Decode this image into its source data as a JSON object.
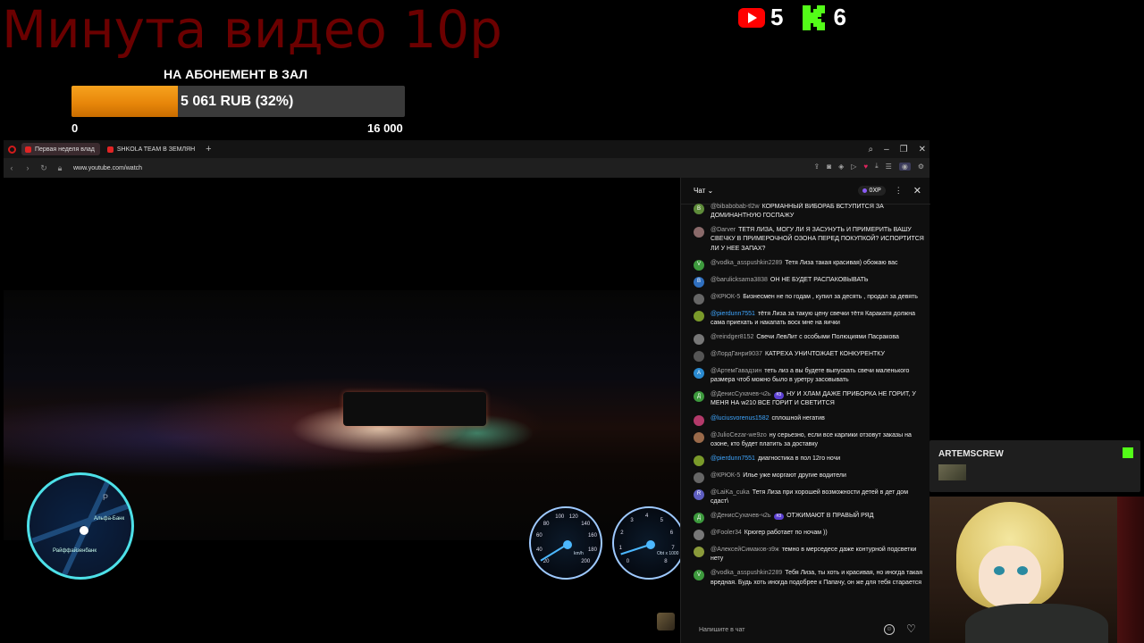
{
  "overlay": {
    "title": "Минута видео 10р",
    "goal": {
      "label": "НА АБОНЕМЕНТ В ЗАЛ",
      "amount_text": "5 061 RUB (32%)",
      "progress_fraction": 0.32,
      "min": "0",
      "max": "16 000"
    },
    "socials": [
      {
        "icon": "youtube-icon",
        "count": "5"
      },
      {
        "icon": "kick-icon",
        "count": "6"
      }
    ],
    "colors": {
      "title": "#6b0000",
      "goal_fill": "#f29513",
      "kick": "#53fc18",
      "youtube": "#ff0000"
    }
  },
  "browser": {
    "tabs": [
      {
        "label": "Первая неделя влад",
        "active": true
      },
      {
        "label": "SHKOLA TEAM В ЗЕМЛЯН",
        "active": false
      }
    ],
    "url": "www.youtube.com/watch"
  },
  "chat": {
    "title": "Чат",
    "xp": "0XP",
    "input_placeholder": "Напишите в чат",
    "messages": [
      {
        "initial": "B",
        "color": "#5e8c3a",
        "name": "@bibabobab-tl2w",
        "text": "КОРМАННЫЙ ВИБОРАБ ВСТУПИТСЯ ЗА ДОМИНАНТНУЮ ГОСПАЖУ",
        "name_blue": false
      },
      {
        "initial": "",
        "color": "#8a6a6a",
        "name": "@Darver",
        "text": "ТЕТЯ ЛИЗА, МОГУ ЛИ Я ЗАСУНУТЬ И ПРИМЕРИТЬ ВАШУ СВЕЧКУ В ПРИМЕРОЧНОЙ ОЗОНА ПЕРЕД ПОКУПКОЙ? ИСПОРТИТСЯ ЛИ У НЕЕ ЗАПАХ?",
        "name_blue": false
      },
      {
        "initial": "V",
        "color": "#3d9a3d",
        "name": "@vodka_asspushkin2289",
        "text": "Тетя Лиза такая красивая) обожаю вас",
        "name_blue": false
      },
      {
        "initial": "B",
        "color": "#2f6fbf",
        "name": "@barulicksama3838",
        "text": "ОН НЕ БУДЕТ РАСПАКОВЫВАТЬ",
        "name_blue": false
      },
      {
        "initial": "",
        "color": "#666",
        "name": "@КРЮК-5",
        "text": "Бизнесмен не по годам , купил за десять , продал за девять",
        "name_blue": false
      },
      {
        "initial": "",
        "color": "#7a9a2a",
        "name": "@pierdunn7551",
        "text": "тётя Лиза за такую цену свечки тётя Каракатя должна сама приехать и накапать воск мне на яички",
        "name_blue": true
      },
      {
        "initial": "",
        "color": "#777",
        "name": "@reindger8152",
        "text": "Свечи ЛевЛит с особыми Полюциями Пасракова",
        "name_blue": false
      },
      {
        "initial": "",
        "color": "#555",
        "name": "@ЛордГанри9037",
        "text": "КАТРЕХА УНИЧТОЖАЕТ КОНКУРЕНТКУ",
        "name_blue": false
      },
      {
        "initial": "A",
        "color": "#2a8ad0",
        "name": "@АртемГавадзин",
        "text": "теть лиз а вы будете выпускать свечи маленького размера чтоб можно было в уретру засовывать",
        "name_blue": false
      },
      {
        "initial": "Д",
        "color": "#3d9a3d",
        "name": "@ДенисСухачев-ч2ь",
        "badge": "#3",
        "text": "НУ И ХЛАМ ДАЖЕ ПРИБОРКА НЕ ГОРИТ, У МЕНЯ НА w210 ВСЕ ГОРИТ И СВЕТИТСЯ",
        "name_blue": false
      },
      {
        "initial": "",
        "color": "#b33a6a",
        "name": "@luciusvorenus1582",
        "text": "сплошной негатив",
        "name_blue": true
      },
      {
        "initial": "",
        "color": "#9a6a4a",
        "name": "@JulioCezar-we9zo",
        "text": "ну серьезно, если все карлики отзовут заказы на озоне, кто будет платить за доставку",
        "name_blue": false
      },
      {
        "initial": "",
        "color": "#7a9a2a",
        "name": "@pierdunn7551",
        "text": "диагностика в пол 12го ночи",
        "name_blue": true
      },
      {
        "initial": "",
        "color": "#666",
        "name": "@КРЮК-5",
        "text": "Илье уже моргают другие водители",
        "name_blue": false
      },
      {
        "initial": "R",
        "color": "#5e5ec0",
        "name": "@LaiKa_cuka",
        "text": "Тетя Лиза при хорошей возможности детей в дет дом сдаст\\",
        "name_blue": false
      },
      {
        "initial": "Д",
        "color": "#3d9a3d",
        "name": "@ДенисСухачев-ч2ь",
        "badge": "#3",
        "text": "ОТЖИМАЮТ В ПРАВЫЙ РЯД",
        "name_blue": false
      },
      {
        "initial": "",
        "color": "#777",
        "name": "@Fooler34",
        "text": "Крюгер работает по ночам ))",
        "name_blue": false
      },
      {
        "initial": "",
        "color": "#8a9a3a",
        "name": "@АлексейСимаков-з9ж",
        "text": "темно в мерседесе даже контурной подсветки нету",
        "name_blue": false
      },
      {
        "initial": "V",
        "color": "#3d9a3d",
        "name": "@vodka_asspushkin2289",
        "text": "Тебя Лиза, ты хоть и красивая, но иногда такая вредная. Будь хоть иногда подобрее к Папачу, он же для тебя старается",
        "name_blue": false
      }
    ]
  },
  "cam_chat": {
    "username": "ARTEMSCREW"
  },
  "game": {
    "map_labels": [
      "Альфа-Банк",
      "Райффайзенбанк",
      "P"
    ],
    "gauge_left": {
      "numbers": [
        "20",
        "40",
        "60",
        "80",
        "100",
        "120",
        "140",
        "160",
        "180",
        "200"
      ],
      "unit": "km/h",
      "value_fraction": 0.05
    },
    "gauge_right": {
      "numbers": [
        "0",
        "1",
        "2",
        "3",
        "4",
        "5",
        "6",
        "7",
        "8"
      ],
      "unit": "Obt x 1000",
      "value_fraction": 0.1
    }
  }
}
